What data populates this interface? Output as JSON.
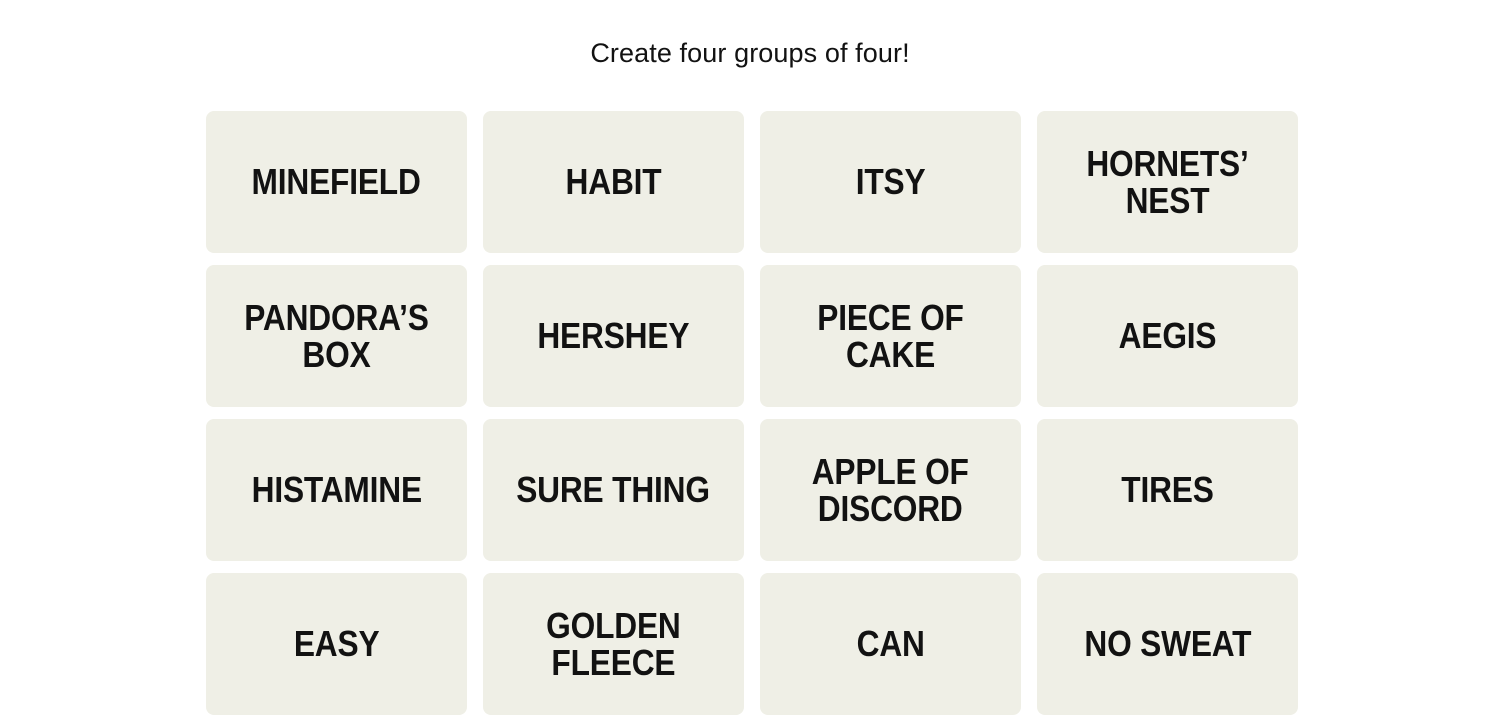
{
  "title": "Create four groups of four!",
  "colors": {
    "page_background": "#FFFFFF",
    "tile_background": "#EFEFE6",
    "text": "#121212"
  },
  "board": {
    "rows": 4,
    "columns": 4,
    "tiles": [
      {
        "label": "MINEFIELD"
      },
      {
        "label": "HABIT"
      },
      {
        "label": "ITSY"
      },
      {
        "label": "HORNETS’ NEST"
      },
      {
        "label": "PANDORA’S BOX"
      },
      {
        "label": "HERSHEY"
      },
      {
        "label": "PIECE OF CAKE"
      },
      {
        "label": "AEGIS"
      },
      {
        "label": "HISTAMINE"
      },
      {
        "label": "SURE THING"
      },
      {
        "label": "APPLE OF\nDISCORD"
      },
      {
        "label": "TIRES"
      },
      {
        "label": "EASY"
      },
      {
        "label": "GOLDEN\nFLEECE"
      },
      {
        "label": "CAN"
      },
      {
        "label": "NO SWEAT"
      }
    ]
  }
}
